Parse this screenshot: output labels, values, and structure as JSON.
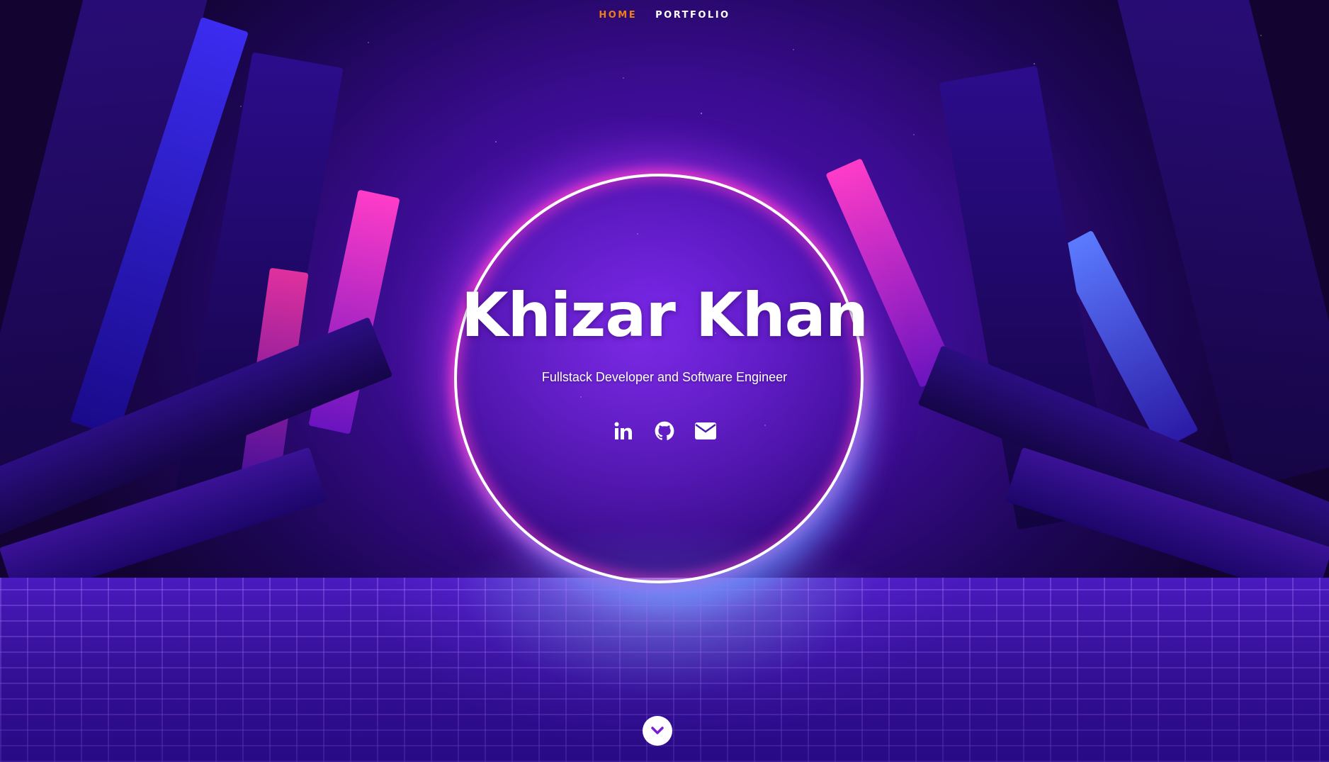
{
  "nav": {
    "items": [
      {
        "label": "HOME",
        "active": true
      },
      {
        "label": "PORTFOLIO",
        "active": false
      }
    ],
    "active_color": "#ef7d1a"
  },
  "hero": {
    "name": "Khizar Khan",
    "tagline": "Fullstack Developer and Software Engineer"
  },
  "socials": [
    {
      "icon": "linkedin-icon"
    },
    {
      "icon": "github-icon"
    },
    {
      "icon": "envelope-icon"
    }
  ],
  "scroll_button": {
    "icon": "chevron-down-icon"
  },
  "colors": {
    "ring": "#ffffff",
    "glow_pink": "#ff3cc8",
    "background_purple": "#5a13c9"
  }
}
